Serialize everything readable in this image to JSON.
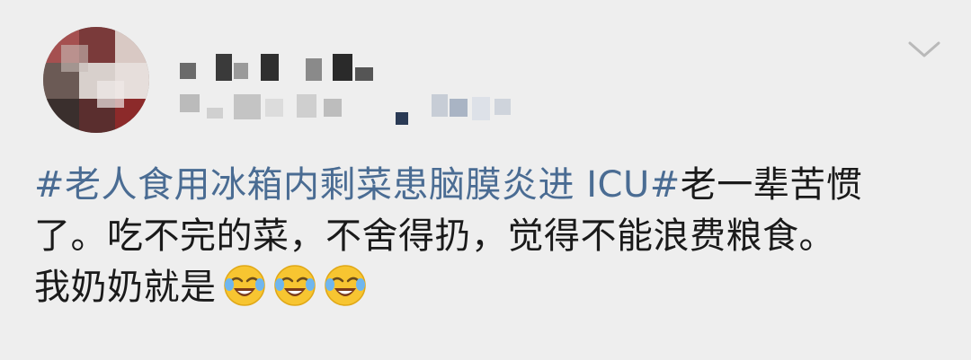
{
  "post": {
    "hashtag": "#老人食用冰箱内剩菜患脑膜炎进 ICU#",
    "line1_rest": "老一辈苦惯",
    "line2": "了。吃不完的菜，不舍得扔，觉得不能浪费粮食。",
    "line3": "我奶奶就是",
    "emojis": [
      "laughing-crying-emoji",
      "laughing-crying-emoji",
      "laughing-crying-emoji"
    ]
  },
  "header": {
    "avatar_icon": "blurred-avatar",
    "username_state": "pixelated",
    "menu_icon": "chevron-down-icon"
  },
  "colors": {
    "background": "#eeeeee",
    "hashtag": "#4a6c93",
    "text": "#1a1a1a"
  }
}
